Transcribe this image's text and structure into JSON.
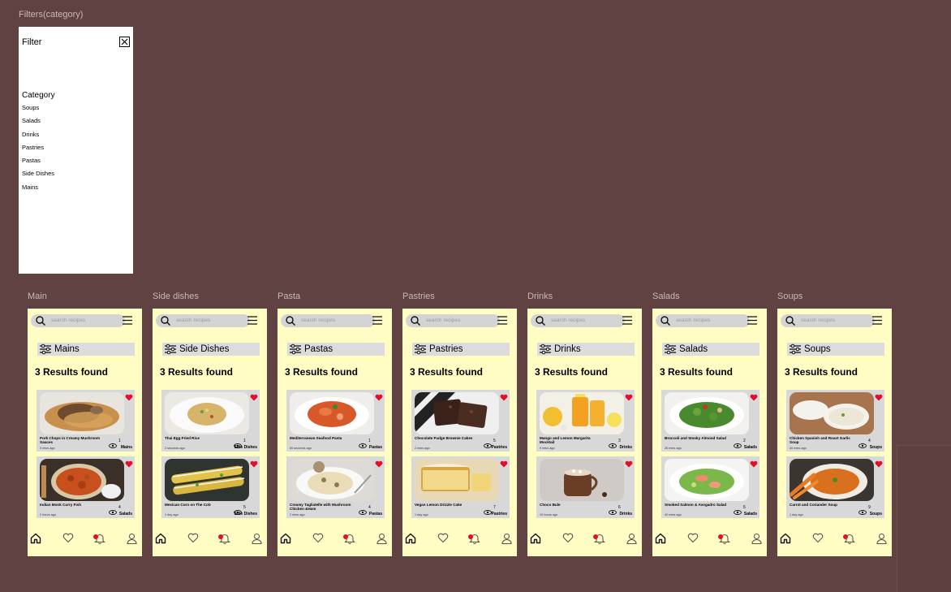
{
  "filter_frame": {
    "label": "Filters(category)",
    "title": "Filter",
    "category_heading": "Category",
    "categories": [
      "Soups",
      "Salads",
      "Drinks",
      "Pastries",
      "Pastas",
      "Side Dishes",
      "Mains"
    ]
  },
  "search_placeholder": "search recipes",
  "results_text": "3 Results found",
  "colors": {
    "canvas": "#614243",
    "phone_bg": "#fffdc4",
    "heart": "#e0102a",
    "notification_dot": "#e0102a"
  },
  "icons": [
    "search-icon",
    "menu-icon",
    "filter-sliders-icon",
    "heart-icon",
    "eye-icon",
    "home-icon",
    "favorites-icon",
    "bell-icon",
    "profile-icon",
    "close-icon"
  ],
  "screens": [
    {
      "frame_label": "Main",
      "category": "Mains",
      "cards": [
        {
          "title": "Pork Chops in Creamy Mushroom Sauces",
          "time": "3 mins ago",
          "views": "1",
          "tag": "Mains",
          "image": "pork-chops"
        },
        {
          "title": "Indian Monk Curry Fish",
          "time": "2 hours ago",
          "views": "4",
          "tag": "Salads",
          "image": "curry-fish"
        }
      ]
    },
    {
      "frame_label": "Side dishes",
      "category": "Side Dishes",
      "cards": [
        {
          "title": "Thai Egg Fried Rice",
          "time": "2 seconds ago",
          "views": "1",
          "tag": "Side Dishes",
          "image": "fried-rice"
        },
        {
          "title": "Mexican Corn on The Cob",
          "time": "1 day ago",
          "views": "5",
          "tag": "Side Dishes",
          "image": "corn"
        }
      ]
    },
    {
      "frame_label": "Pasta",
      "category": "Pastas",
      "cards": [
        {
          "title": "Mediterranean Seafood Pasta",
          "time": "50 seconds ago",
          "views": "1",
          "tag": "Pastas",
          "image": "seafood-pasta"
        },
        {
          "title": "Creamy Tagliatelle with Mushroom Chicken &Ham",
          "time": "2 mins ago",
          "views": "4",
          "tag": "Pastas",
          "image": "tagliatelle"
        }
      ]
    },
    {
      "frame_label": "Pastries",
      "category": "Pastries",
      "cards": [
        {
          "title": "Chocolate Fudge Brownie Cakes",
          "time": "2 mins ago",
          "views": "5",
          "tag": "Pastries",
          "image": "brownie"
        },
        {
          "title": "Vegan Lemon Drizzle Cake",
          "time": "1 day ago",
          "views": "7",
          "tag": "Pastries",
          "image": "lemon-cake"
        }
      ]
    },
    {
      "frame_label": "Drinks",
      "category": "Drinks",
      "cards": [
        {
          "title": "Mango and Lemon Margarita Mocktail",
          "time": "9 mins ago",
          "views": "3",
          "tag": "Drinks",
          "image": "mango-mocktail"
        },
        {
          "title": "Choco Bule",
          "time": "10 hours ago",
          "views": "6",
          "tag": "Drinks",
          "image": "hot-chocolate"
        }
      ]
    },
    {
      "frame_label": "Salads",
      "category": "Salads",
      "cards": [
        {
          "title": "Broccoli and Smoky Almond Salad",
          "time": "26 mins ago",
          "views": "2",
          "tag": "Salads",
          "image": "broccoli-salad"
        },
        {
          "title": "Smoked Salmon & Avogadro Salad",
          "time": "40 mins ago",
          "views": "5",
          "tag": "Salads",
          "image": "salmon-salad"
        }
      ]
    },
    {
      "frame_label": "Soups",
      "category": "Soups",
      "cards": [
        {
          "title": "Chicken Spanish and Roast Garlic Soup",
          "time": "30 mins ago",
          "views": "4",
          "tag": "Soups",
          "image": "chicken-soup"
        },
        {
          "title": "Carrot and Coriander Soup",
          "time": "1 day ago",
          "views": "9",
          "tag": "Soups",
          "image": "carrot-soup"
        }
      ]
    }
  ]
}
